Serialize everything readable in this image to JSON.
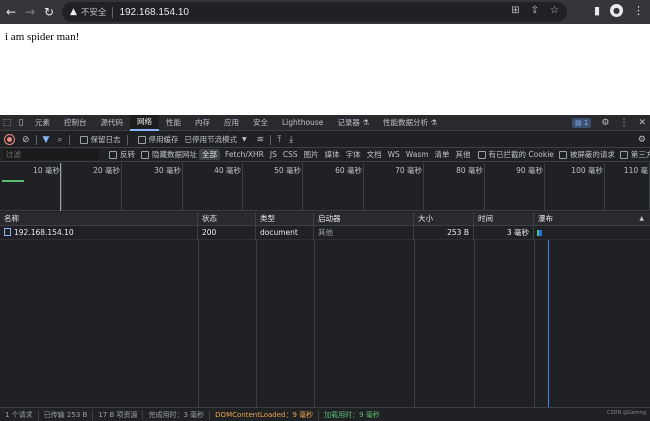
{
  "browser": {
    "security_label": "不安全",
    "url": "192.168.154.10"
  },
  "page": {
    "text": "i am spider man!"
  },
  "devtools": {
    "tabs": [
      "元素",
      "控制台",
      "源代码",
      "网络",
      "性能",
      "内存",
      "应用",
      "安全",
      "Lighthouse",
      "记录器 ⚗",
      "性能数据分析 ⚗"
    ],
    "active_tab": "网络",
    "issues_badge": "1",
    "toolbar1": {
      "preserve_log": "保留日志",
      "disable_cache": "停用缓存",
      "throttle": "已停用节流模式"
    },
    "toolbar2": {
      "filter_placeholder": "过滤",
      "invert": "反转",
      "hide_data_urls": "隐藏数据网址",
      "types": [
        "全部",
        "Fetch/XHR",
        "JS",
        "CSS",
        "图片",
        "媒体",
        "字体",
        "文档",
        "WS",
        "Wasm",
        "清单",
        "其他"
      ],
      "active_type": "全部",
      "blocked_cookies": "有已拦截的 Cookie",
      "blocked_requests": "被屏蔽的请求",
      "third_party": "第三方请求"
    },
    "overview_ticks": [
      "10 毫秒",
      "20 毫秒",
      "30 毫秒",
      "40 毫秒",
      "50 毫秒",
      "60 毫秒",
      "70 毫秒",
      "80 毫秒",
      "90 毫秒",
      "100 毫秒",
      "110 毫"
    ],
    "columns": [
      "名称",
      "状态",
      "类型",
      "启动器",
      "大小",
      "时间",
      "瀑布"
    ],
    "rows": [
      {
        "name": "192.168.154.10",
        "status": "200",
        "type": "document",
        "initiator": "其他",
        "size": "253 B",
        "time": "3 毫秒"
      }
    ],
    "status": {
      "requests": "1 个请求",
      "transferred": "已传输 253 B",
      "resources": "17 B 项资源",
      "finish": "完成用时：3 毫秒",
      "dcl": "DOMContentLoaded：9 毫秒",
      "load": "加载用时：9 毫秒"
    },
    "watermark": "CSDN @Gemng"
  },
  "colors": {
    "accent": "#8ab4f8",
    "record": "#f28b82",
    "dcl": "#e8a54d",
    "load": "#5bb974"
  }
}
